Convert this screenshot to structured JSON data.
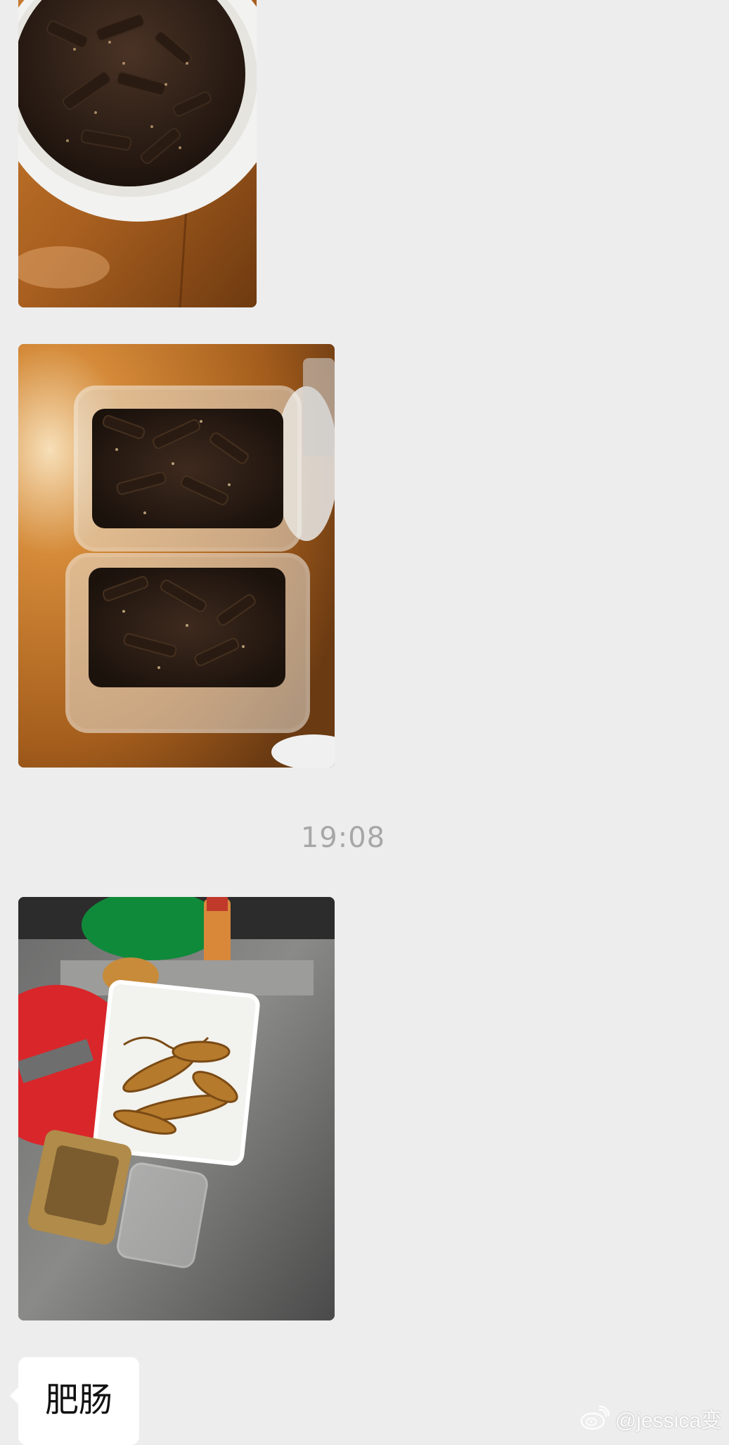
{
  "chat": {
    "messages": [
      {
        "type": "image",
        "description": "bowl-of-spiced-beef-strips"
      },
      {
        "type": "image",
        "description": "two-containers-of-spiced-beef-strips"
      },
      {
        "type": "timestamp",
        "text": "19:08"
      },
      {
        "type": "image",
        "description": "braised-intestines-on-steel-table"
      },
      {
        "type": "text",
        "text": "肥肠"
      }
    ],
    "timestamp": "19:08",
    "last_text": "肥肠"
  },
  "watermark": {
    "icon": "weibo-icon",
    "text": "@jessica变"
  },
  "colors": {
    "background": "#ededed",
    "bubble": "#ffffff",
    "timestamp": "#a7a7a7"
  }
}
